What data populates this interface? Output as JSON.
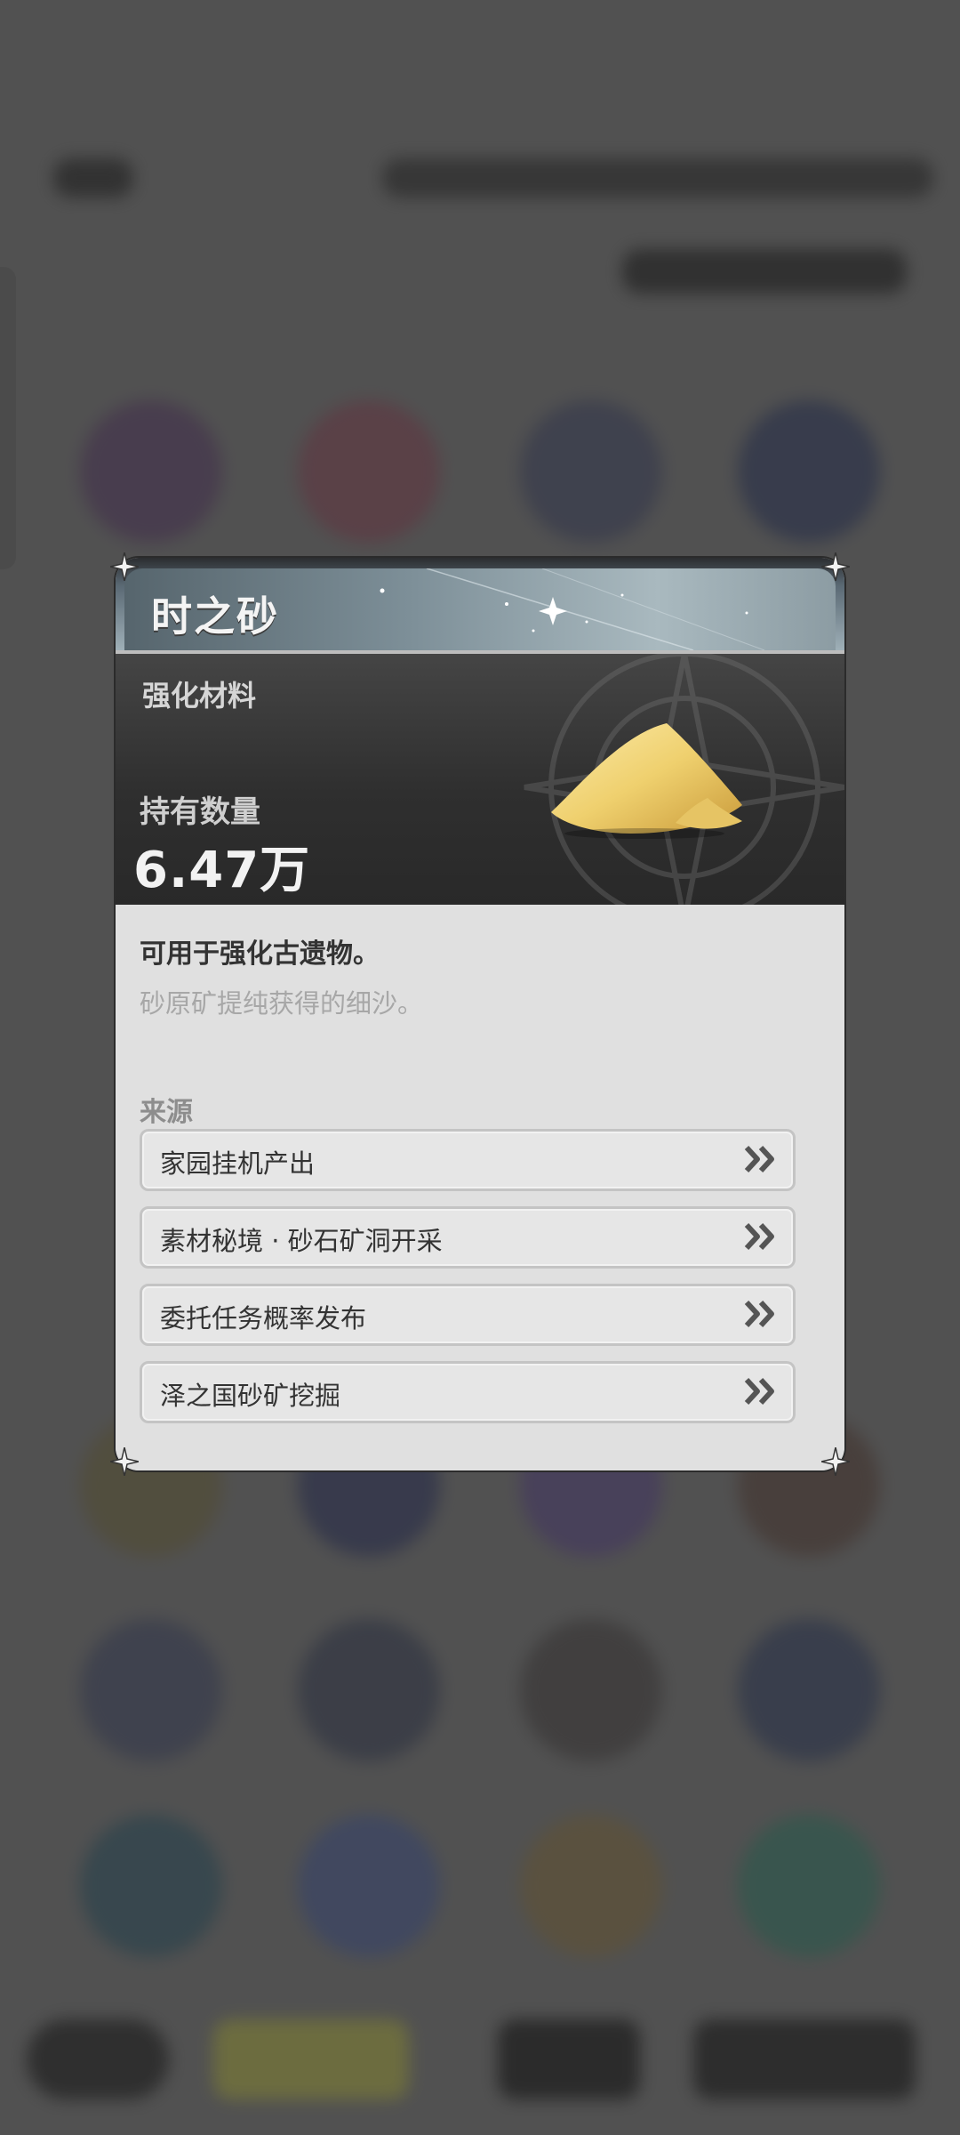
{
  "dialog": {
    "title": "时之砂",
    "category": "强化材料",
    "owned_label": "持有数量",
    "owned_value": "6.47万",
    "description": "可用于强化古遗物。",
    "flavor_text": "砂原矿提纯获得的细沙。",
    "sources_label": "来源",
    "sources": [
      {
        "label": "家园挂机产出"
      },
      {
        "label": "素材秘境 · 砂石矿洞开采"
      },
      {
        "label": "委托任务概率发布"
      },
      {
        "label": "泽之国砂矿挖掘"
      }
    ],
    "item_icon": "sand-pile-icon"
  },
  "colors": {
    "overlay": "#5a5a5a",
    "header_dark": "#2f2f2f",
    "body_light": "#e0e0e0",
    "accent_gold": "#f0d27a"
  }
}
